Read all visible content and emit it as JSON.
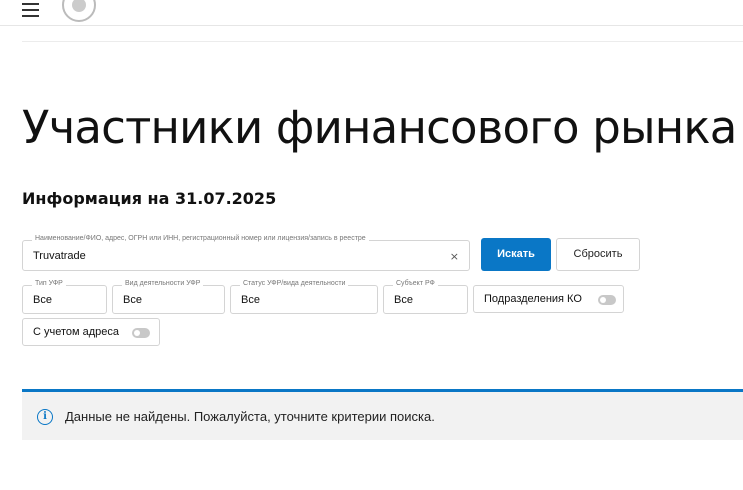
{
  "page": {
    "title": "Участники финансового рынка",
    "info_date": "Информация на 31.07.2025"
  },
  "search": {
    "label": "Наименование/ФИО, адрес, ОГРН или ИНН, регистрационный номер или лицензия/запись в реестре",
    "value": "Truvatrade",
    "clear_icon": "×"
  },
  "buttons": {
    "search": "Искать",
    "reset": "Сбросить"
  },
  "filters": [
    {
      "label": "Тип УФР",
      "value": "Все"
    },
    {
      "label": "Вид деятельности УФР",
      "value": "Все"
    },
    {
      "label": "Статус УФР/вида деятельности",
      "value": "Все"
    },
    {
      "label": "Субъект РФ",
      "value": "Все"
    }
  ],
  "toggles": {
    "branches": "Подразделения КО",
    "with_address": "С учетом адреса"
  },
  "notice": {
    "icon": "i",
    "text": "Данные не найдены. Пожалуйста, уточните критерии поиска."
  },
  "colors": {
    "accent": "#0a77c6",
    "notice_bg": "#f2f2f2"
  }
}
